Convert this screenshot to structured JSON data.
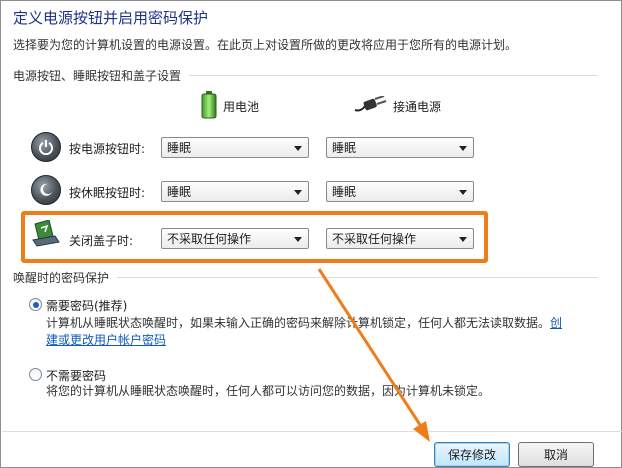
{
  "page": {
    "title": "定义电源按钮并启用密码保护",
    "description": "选择要为您的计算机设置的电源设置。在此页上对设置所做的更改将应用于您所有的电源计划。"
  },
  "power_section": {
    "title": "电源按钮、睡眠按钮和盖子设置",
    "col_battery": "用电池",
    "col_plugged": "接通电源",
    "rows": [
      {
        "label": "按电源按钮时:",
        "battery": "睡眠",
        "plugged": "睡眠"
      },
      {
        "label": "按休眠按钮时:",
        "battery": "睡眠",
        "plugged": "睡眠"
      },
      {
        "label": "关闭盖子时:",
        "battery": "不采取任何操作",
        "plugged": "不采取任何操作"
      }
    ]
  },
  "wake_section": {
    "title": "唤醒时的密码保护",
    "option_require": {
      "label": "需要密码(推荐)",
      "desc": "计算机从睡眠状态唤醒时，如果未输入正确的密码来解除计算机锁定，任何人都无法读取数据。",
      "link_part1": "创",
      "link_part2": "建或更改用户帐户密码",
      "selected": true
    },
    "option_norequire": {
      "label": "不需要密码",
      "desc": "将您的计算机从睡眠状态唤醒时，任何人都可以访问您的数据，因为计算机未锁定。",
      "selected": false
    }
  },
  "buttons": {
    "save": "保存修改",
    "cancel": "取消"
  },
  "colors": {
    "title": "#1e3287",
    "highlight": "#f07d1a",
    "link": "#0f5bb8"
  }
}
